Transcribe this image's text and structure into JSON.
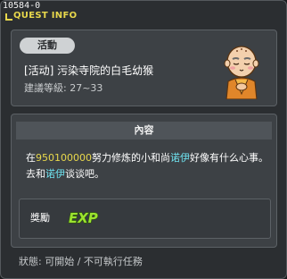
{
  "window": {
    "quest_id": "10584-0",
    "title": "QUEST INFO"
  },
  "quest": {
    "category": "活動",
    "name": "[活动] 污染寺院的白毛幼猴",
    "level": "建議等級: 27~33"
  },
  "content": {
    "header": "內容",
    "text_parts": {
      "p1": "在",
      "map": "950100000",
      "p2": "努力修炼的小和尚",
      "npc1": "诺伊",
      "p3": "好像有什么心事。去和",
      "npc2": "诺伊",
      "p4": "谈谈吧。"
    }
  },
  "reward": {
    "label": "獎勵",
    "item": "EXP"
  },
  "status": {
    "text": "狀態: 可開始 / 不可執行任務"
  },
  "colors": {
    "title": "#e8d84c",
    "map_highlight": "#e8d84c",
    "npc_highlight": "#6fe3f0",
    "badge_bg": "#cfd2d4"
  },
  "icons": {
    "title": "corner-bracket-icon",
    "npc": "monk-portrait",
    "reward": "exp-icon"
  }
}
